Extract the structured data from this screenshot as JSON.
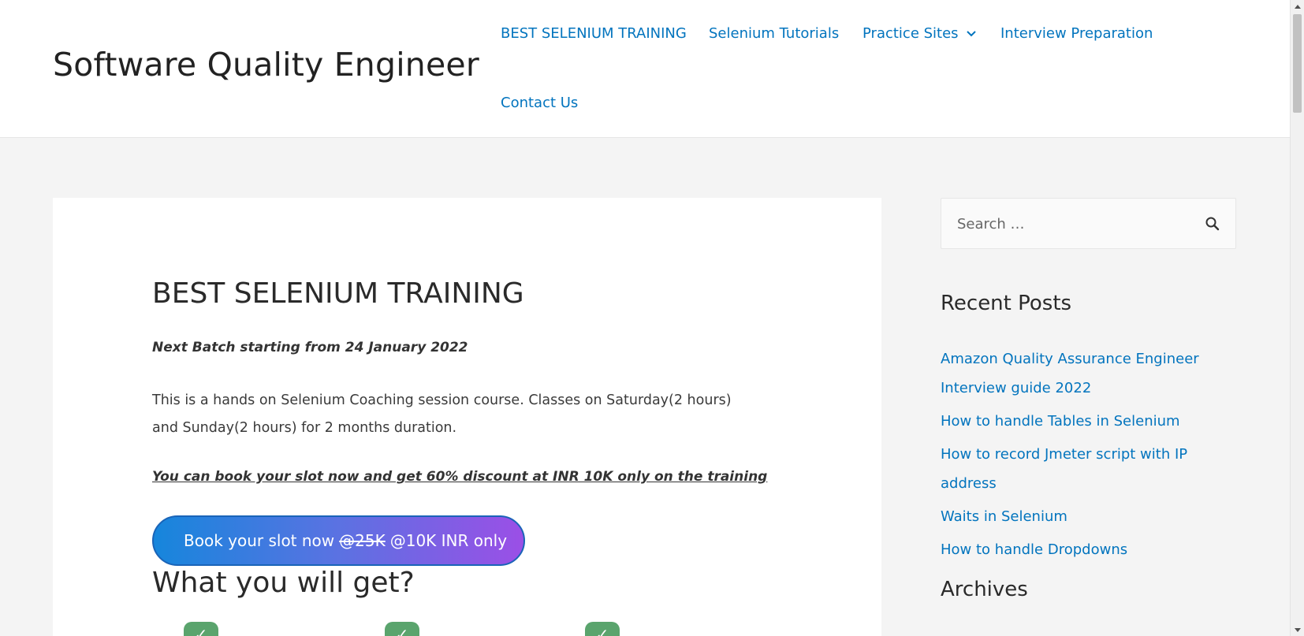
{
  "header": {
    "site_title": "Software Quality Engineer",
    "nav": [
      {
        "label": "BEST SELENIUM TRAINING"
      },
      {
        "label": "Selenium Tutorials"
      },
      {
        "label": "Practice Sites",
        "has_dropdown": true
      },
      {
        "label": "Interview Preparation"
      },
      {
        "label": "Contact Us"
      }
    ]
  },
  "main": {
    "title": "BEST SELENIUM TRAINING",
    "batch_line": "Next Batch starting from 24 January 2022",
    "intro": "This is a hands on Selenium Coaching session course. Classes on Saturday(2 hours) and Sunday(2 hours) for 2 months duration.",
    "discount_line": "You can book your slot now and get 60% discount at INR 10K only on the training",
    "book_button": {
      "prefix": "Book your slot now",
      "old_price": "@25K",
      "new_price": "@10K INR only"
    },
    "section_heading": "What you will get?"
  },
  "sidebar": {
    "search_placeholder": "Search …",
    "recent_posts_title": "Recent Posts",
    "recent_posts": [
      "Amazon Quality Assurance Engineer Interview guide 2022",
      "How to handle Tables in Selenium",
      "How to record Jmeter script with IP address",
      "Waits in Selenium",
      "How to handle Dropdowns"
    ],
    "archives_title": "Archives"
  },
  "colors": {
    "link": "#0274be",
    "button_gradient_start": "#1686dc",
    "button_gradient_end": "#9b4fe6",
    "check_icon": "#5aa46d"
  },
  "icons": {
    "dropdown": "chevron-down-icon",
    "search": "search-icon",
    "feature": "check-icon"
  }
}
